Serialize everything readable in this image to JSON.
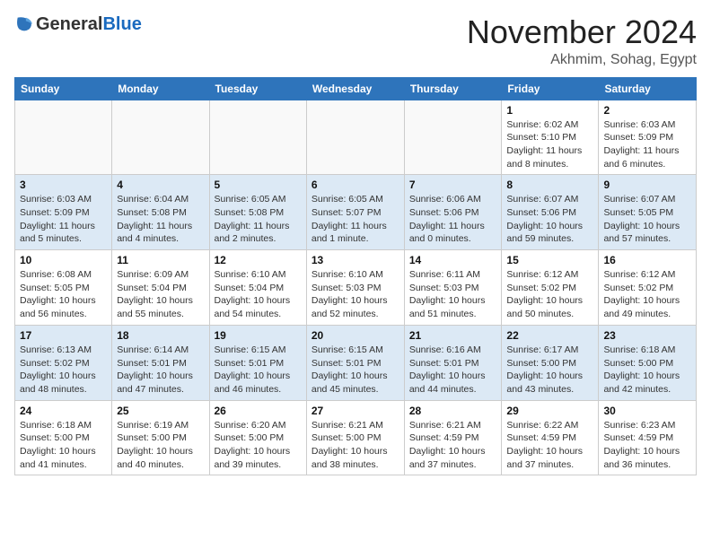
{
  "header": {
    "logo_general": "General",
    "logo_blue": "Blue",
    "month_title": "November 2024",
    "location": "Akhmim, Sohag, Egypt"
  },
  "days_of_week": [
    "Sunday",
    "Monday",
    "Tuesday",
    "Wednesday",
    "Thursday",
    "Friday",
    "Saturday"
  ],
  "weeks": [
    [
      {
        "day": "",
        "detail": ""
      },
      {
        "day": "",
        "detail": ""
      },
      {
        "day": "",
        "detail": ""
      },
      {
        "day": "",
        "detail": ""
      },
      {
        "day": "",
        "detail": ""
      },
      {
        "day": "1",
        "detail": "Sunrise: 6:02 AM\nSunset: 5:10 PM\nDaylight: 11 hours and 8 minutes."
      },
      {
        "day": "2",
        "detail": "Sunrise: 6:03 AM\nSunset: 5:09 PM\nDaylight: 11 hours and 6 minutes."
      }
    ],
    [
      {
        "day": "3",
        "detail": "Sunrise: 6:03 AM\nSunset: 5:09 PM\nDaylight: 11 hours and 5 minutes."
      },
      {
        "day": "4",
        "detail": "Sunrise: 6:04 AM\nSunset: 5:08 PM\nDaylight: 11 hours and 4 minutes."
      },
      {
        "day": "5",
        "detail": "Sunrise: 6:05 AM\nSunset: 5:08 PM\nDaylight: 11 hours and 2 minutes."
      },
      {
        "day": "6",
        "detail": "Sunrise: 6:05 AM\nSunset: 5:07 PM\nDaylight: 11 hours and 1 minute."
      },
      {
        "day": "7",
        "detail": "Sunrise: 6:06 AM\nSunset: 5:06 PM\nDaylight: 11 hours and 0 minutes."
      },
      {
        "day": "8",
        "detail": "Sunrise: 6:07 AM\nSunset: 5:06 PM\nDaylight: 10 hours and 59 minutes."
      },
      {
        "day": "9",
        "detail": "Sunrise: 6:07 AM\nSunset: 5:05 PM\nDaylight: 10 hours and 57 minutes."
      }
    ],
    [
      {
        "day": "10",
        "detail": "Sunrise: 6:08 AM\nSunset: 5:05 PM\nDaylight: 10 hours and 56 minutes."
      },
      {
        "day": "11",
        "detail": "Sunrise: 6:09 AM\nSunset: 5:04 PM\nDaylight: 10 hours and 55 minutes."
      },
      {
        "day": "12",
        "detail": "Sunrise: 6:10 AM\nSunset: 5:04 PM\nDaylight: 10 hours and 54 minutes."
      },
      {
        "day": "13",
        "detail": "Sunrise: 6:10 AM\nSunset: 5:03 PM\nDaylight: 10 hours and 52 minutes."
      },
      {
        "day": "14",
        "detail": "Sunrise: 6:11 AM\nSunset: 5:03 PM\nDaylight: 10 hours and 51 minutes."
      },
      {
        "day": "15",
        "detail": "Sunrise: 6:12 AM\nSunset: 5:02 PM\nDaylight: 10 hours and 50 minutes."
      },
      {
        "day": "16",
        "detail": "Sunrise: 6:12 AM\nSunset: 5:02 PM\nDaylight: 10 hours and 49 minutes."
      }
    ],
    [
      {
        "day": "17",
        "detail": "Sunrise: 6:13 AM\nSunset: 5:02 PM\nDaylight: 10 hours and 48 minutes."
      },
      {
        "day": "18",
        "detail": "Sunrise: 6:14 AM\nSunset: 5:01 PM\nDaylight: 10 hours and 47 minutes."
      },
      {
        "day": "19",
        "detail": "Sunrise: 6:15 AM\nSunset: 5:01 PM\nDaylight: 10 hours and 46 minutes."
      },
      {
        "day": "20",
        "detail": "Sunrise: 6:15 AM\nSunset: 5:01 PM\nDaylight: 10 hours and 45 minutes."
      },
      {
        "day": "21",
        "detail": "Sunrise: 6:16 AM\nSunset: 5:01 PM\nDaylight: 10 hours and 44 minutes."
      },
      {
        "day": "22",
        "detail": "Sunrise: 6:17 AM\nSunset: 5:00 PM\nDaylight: 10 hours and 43 minutes."
      },
      {
        "day": "23",
        "detail": "Sunrise: 6:18 AM\nSunset: 5:00 PM\nDaylight: 10 hours and 42 minutes."
      }
    ],
    [
      {
        "day": "24",
        "detail": "Sunrise: 6:18 AM\nSunset: 5:00 PM\nDaylight: 10 hours and 41 minutes."
      },
      {
        "day": "25",
        "detail": "Sunrise: 6:19 AM\nSunset: 5:00 PM\nDaylight: 10 hours and 40 minutes."
      },
      {
        "day": "26",
        "detail": "Sunrise: 6:20 AM\nSunset: 5:00 PM\nDaylight: 10 hours and 39 minutes."
      },
      {
        "day": "27",
        "detail": "Sunrise: 6:21 AM\nSunset: 5:00 PM\nDaylight: 10 hours and 38 minutes."
      },
      {
        "day": "28",
        "detail": "Sunrise: 6:21 AM\nSunset: 4:59 PM\nDaylight: 10 hours and 37 minutes."
      },
      {
        "day": "29",
        "detail": "Sunrise: 6:22 AM\nSunset: 4:59 PM\nDaylight: 10 hours and 37 minutes."
      },
      {
        "day": "30",
        "detail": "Sunrise: 6:23 AM\nSunset: 4:59 PM\nDaylight: 10 hours and 36 minutes."
      }
    ]
  ]
}
